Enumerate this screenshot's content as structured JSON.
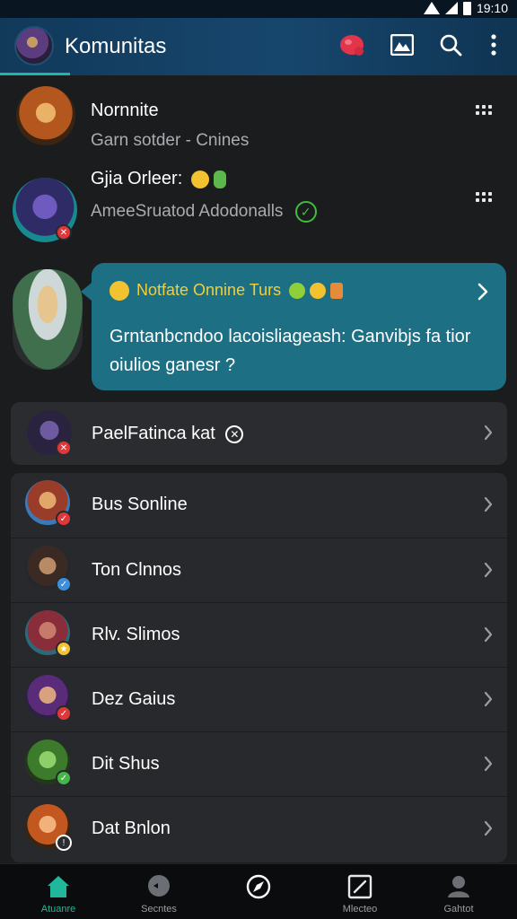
{
  "status_bar": {
    "time": "19:10"
  },
  "app_bar": {
    "title": "Komunitas",
    "accent": "#1fb6a5"
  },
  "feed": [
    {
      "title": "Nornnite",
      "subtitle": "Garn sotder - Cnines"
    },
    {
      "title": "Gjia Orleer:",
      "subtitle": "AmeeSruatod Adodonalls"
    }
  ],
  "notification": {
    "title": "Notfate Onnine Turs",
    "message": "Grntanbcndoo lacoisliageash: Ganvibjs fa tior oiulios ganesr ?"
  },
  "single_item": {
    "title": "PaelFatinca kat"
  },
  "list": [
    {
      "title": "Bus Sonline",
      "badge_color": "#e0383a"
    },
    {
      "title": "Ton Clnnos",
      "badge_color": "#3d8fdc"
    },
    {
      "title": "Rlv. Slimos",
      "badge_color": "#f2c230"
    },
    {
      "title": "Dez Gaius",
      "badge_color": "#e0383a"
    },
    {
      "title": "Dit Shus",
      "badge_color": "#45b64a"
    },
    {
      "title": "Dat Bnlon",
      "badge_color": "#2b2c2f"
    }
  ],
  "bottom_nav": [
    {
      "label": "Atuanre",
      "icon": "home-icon",
      "active": true
    },
    {
      "label": "Secntes",
      "icon": "chat-icon",
      "active": false
    },
    {
      "label": "",
      "icon": "compass-icon",
      "active": false
    },
    {
      "label": "Mlecteo",
      "icon": "edit-icon",
      "active": false
    },
    {
      "label": "Gahtot",
      "icon": "profile-icon",
      "active": false
    }
  ]
}
